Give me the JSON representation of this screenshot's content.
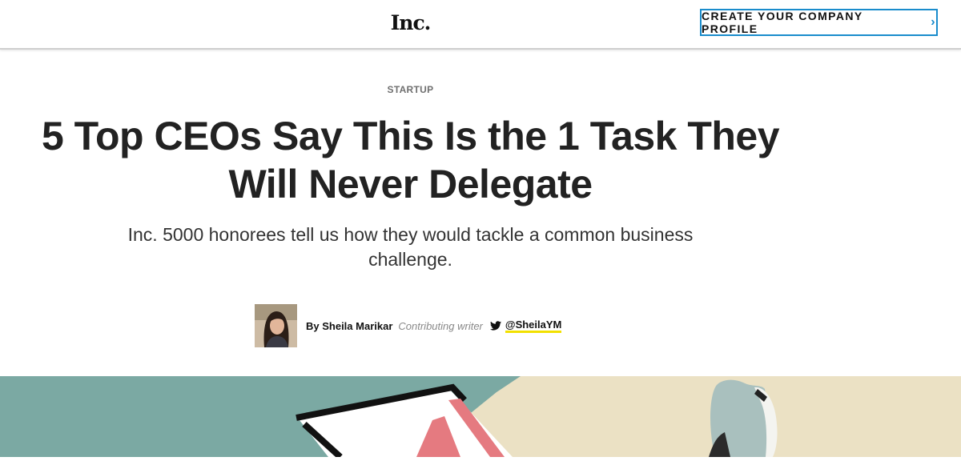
{
  "header": {
    "logo": "Inc.",
    "cta_label": "CREATE YOUR COMPANY PROFILE"
  },
  "article": {
    "category": "STARTUP",
    "headline": "5 Top CEOs Say This Is the 1 Task They Will Never Delegate",
    "dek": "Inc. 5000 honorees tell us how they would tackle a common business challenge.",
    "author": {
      "name": "By Sheila Marikar",
      "role": "Contributing writer",
      "twitter_handle": "@SheilaYM"
    }
  },
  "icons": {
    "cta": "chevron-right-icon",
    "social": "twitter-icon"
  },
  "colors": {
    "accent_blue": "#1a8ccc",
    "handle_underline": "#f2e000",
    "hero_teal": "#7ba9a3",
    "hero_cream": "#ebe1c4"
  }
}
